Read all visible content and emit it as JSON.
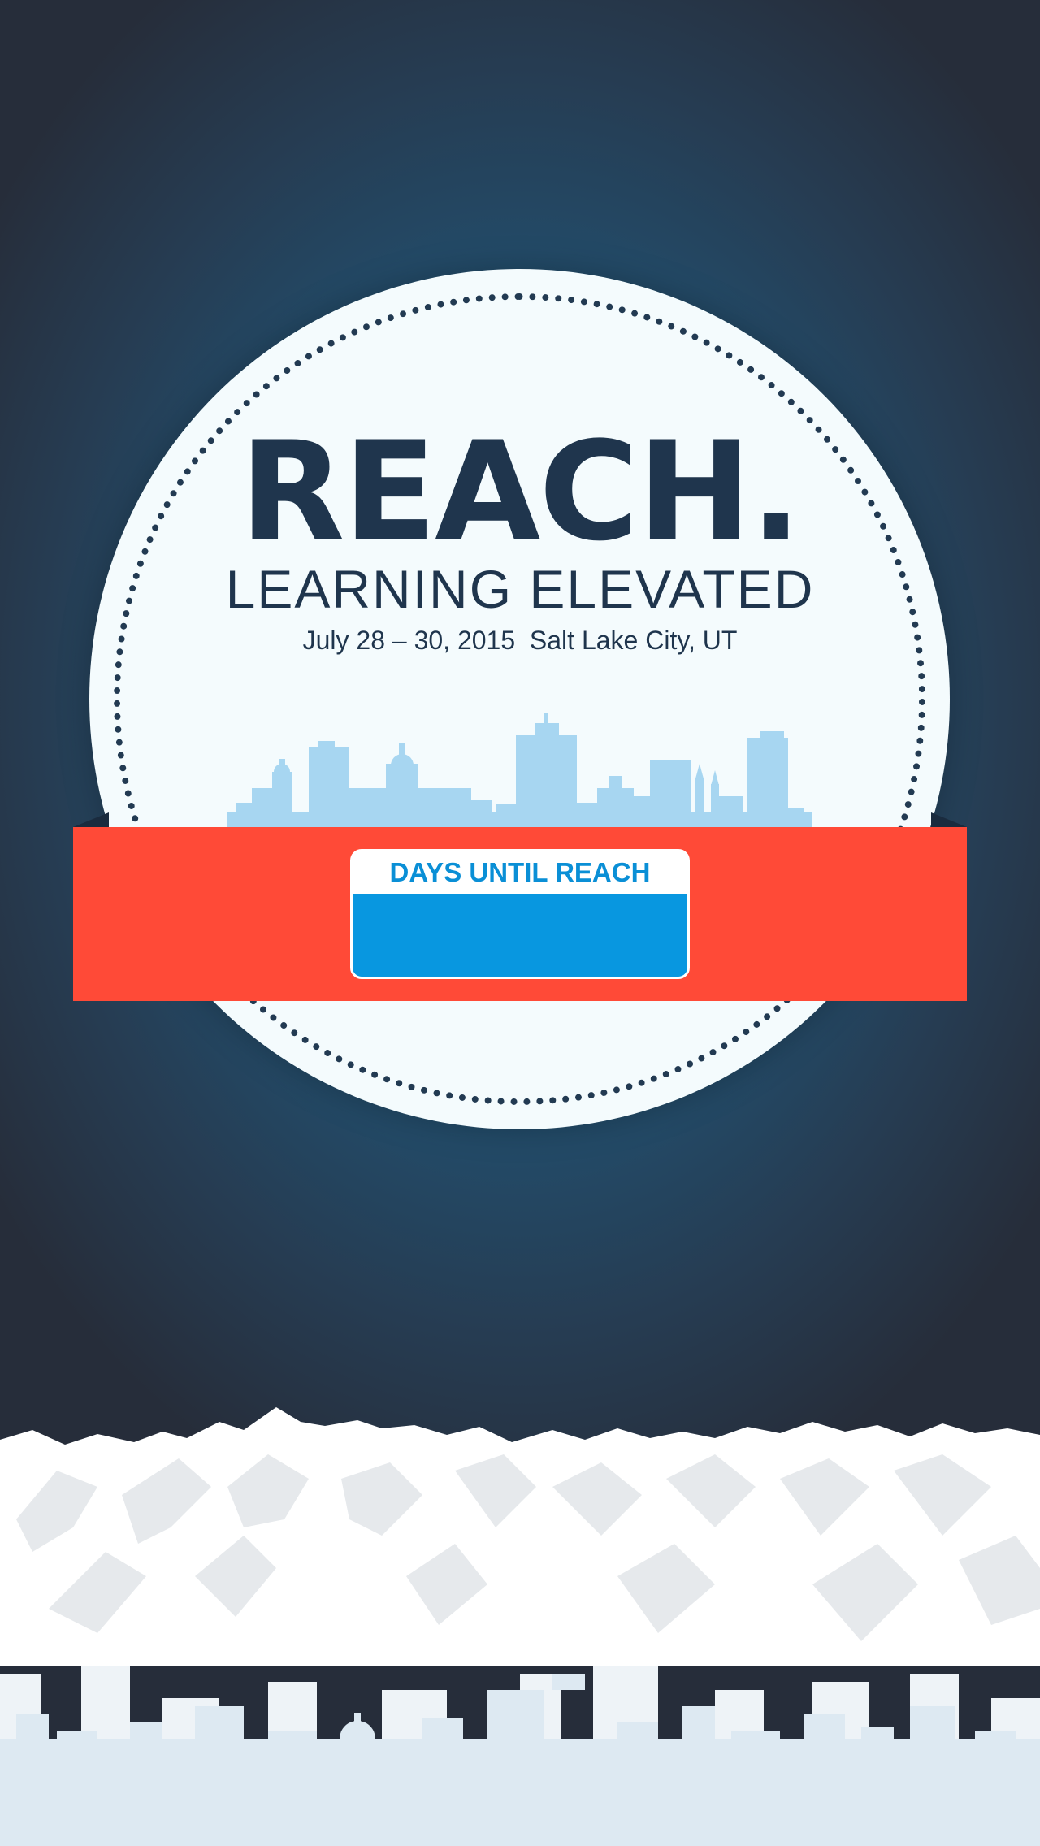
{
  "event": {
    "headline": "REACH.",
    "tagline": "LEARNING ELEVATED",
    "dateline": "July 28 – 30, 2015  Salt Lake City, UT"
  },
  "countdown": {
    "label": "DAYS UNTIL REACH",
    "value": ""
  },
  "colors": {
    "navy": "#1f354d",
    "ribbon": "#ff4a37",
    "counter_blue": "#0897e0",
    "counter_text": "#0a8fd6",
    "skyline": "#a7d6f1",
    "badge_bg": "#f4fbfd"
  },
  "icons": [
    "city-skyline-illustration",
    "mountain-range-illustration",
    "city-skyline-background"
  ]
}
